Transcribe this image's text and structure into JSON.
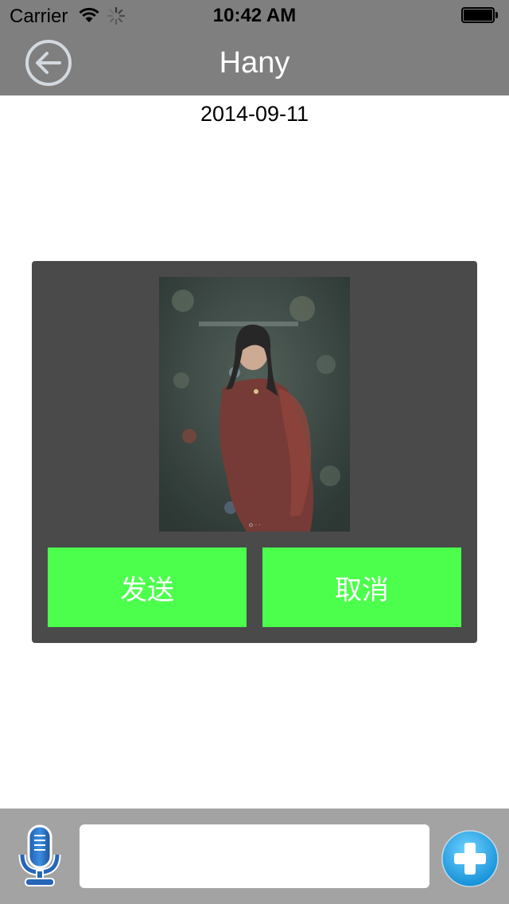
{
  "status_bar": {
    "carrier": "Carrier",
    "time": "10:42 AM",
    "icons": [
      "wifi-icon",
      "activity-spinner-icon",
      "battery-icon"
    ]
  },
  "nav": {
    "back_icon": "arrow-left-circle-icon",
    "title": "Hany"
  },
  "chat": {
    "date": "2014-09-11"
  },
  "image_send_dialog": {
    "preview_image": "photo of woman in red dress against dark green background",
    "send_label": "发送",
    "cancel_label": "取消",
    "button_color": "#4cff4c",
    "panel_color": "#4a4a4a"
  },
  "input_bar": {
    "mic_icon": "microphone-icon",
    "message_value": "",
    "add_icon": "plus-circle-icon"
  },
  "colors": {
    "nav_bar": "#7f7f7f",
    "input_bar": "#a3a3a3"
  }
}
